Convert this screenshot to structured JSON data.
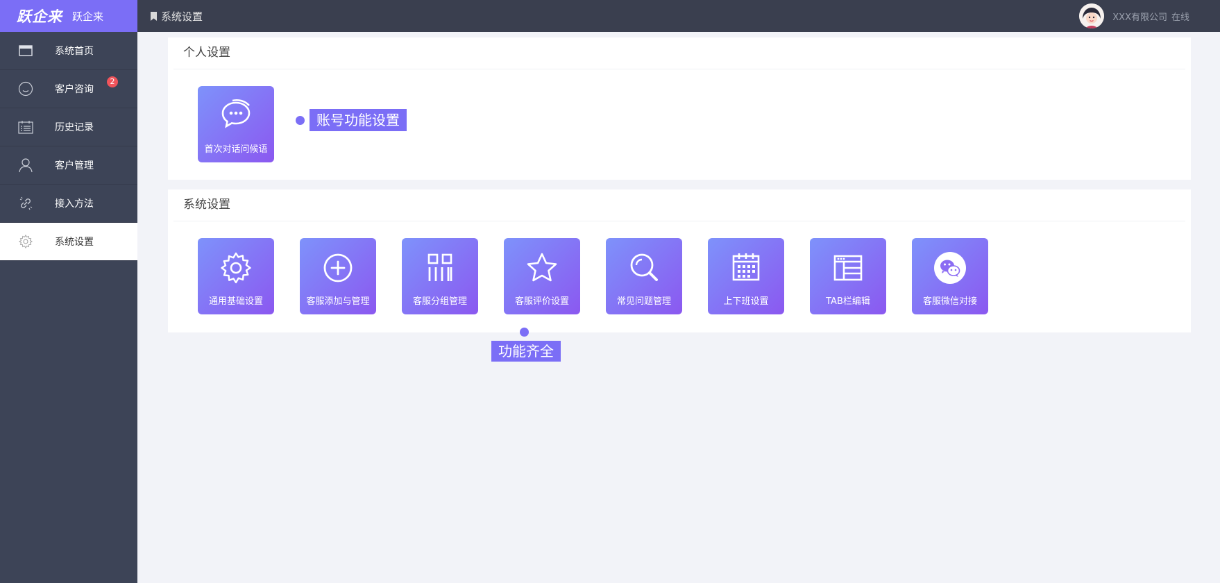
{
  "logo": {
    "brand": "跃企来",
    "name": "跃企来"
  },
  "header": {
    "breadcrumb": "系统设置",
    "company": "XXX有限公司",
    "status": "在线"
  },
  "sidebar": {
    "items": [
      {
        "label": "系统首页",
        "icon": "window-icon"
      },
      {
        "label": "客户咨询",
        "icon": "smile-icon",
        "badge": "2"
      },
      {
        "label": "历史记录",
        "icon": "calendar-list-icon"
      },
      {
        "label": "客户管理",
        "icon": "user-icon"
      },
      {
        "label": "接入方法",
        "icon": "link-icon"
      },
      {
        "label": "系统设置",
        "icon": "gear-icon",
        "active": true
      }
    ]
  },
  "personal": {
    "title": "个人设置",
    "tiles": [
      {
        "label": "首次对话问候语",
        "icon": "chat-bubble-icon"
      }
    ]
  },
  "system": {
    "title": "系统设置",
    "tiles": [
      {
        "label": "通用基础设置",
        "icon": "gear-icon"
      },
      {
        "label": "客服添加与管理",
        "icon": "plus-circle-icon"
      },
      {
        "label": "客服分组管理",
        "icon": "group-grid-icon"
      },
      {
        "label": "客服评价设置",
        "icon": "star-icon"
      },
      {
        "label": "常见问题管理",
        "icon": "search-icon"
      },
      {
        "label": "上下班设置",
        "icon": "calendar-icon"
      },
      {
        "label": "TAB栏编辑",
        "icon": "browser-window-icon"
      },
      {
        "label": "客服微信对接",
        "icon": "wechat-icon"
      }
    ]
  },
  "callouts": {
    "account": "账号功能设置",
    "features": "功能齐全"
  },
  "colors": {
    "accent": "#7b6ef6",
    "sidebar": "#3d4457",
    "topbar": "#3a3f4f",
    "badge": "#f0545b"
  }
}
